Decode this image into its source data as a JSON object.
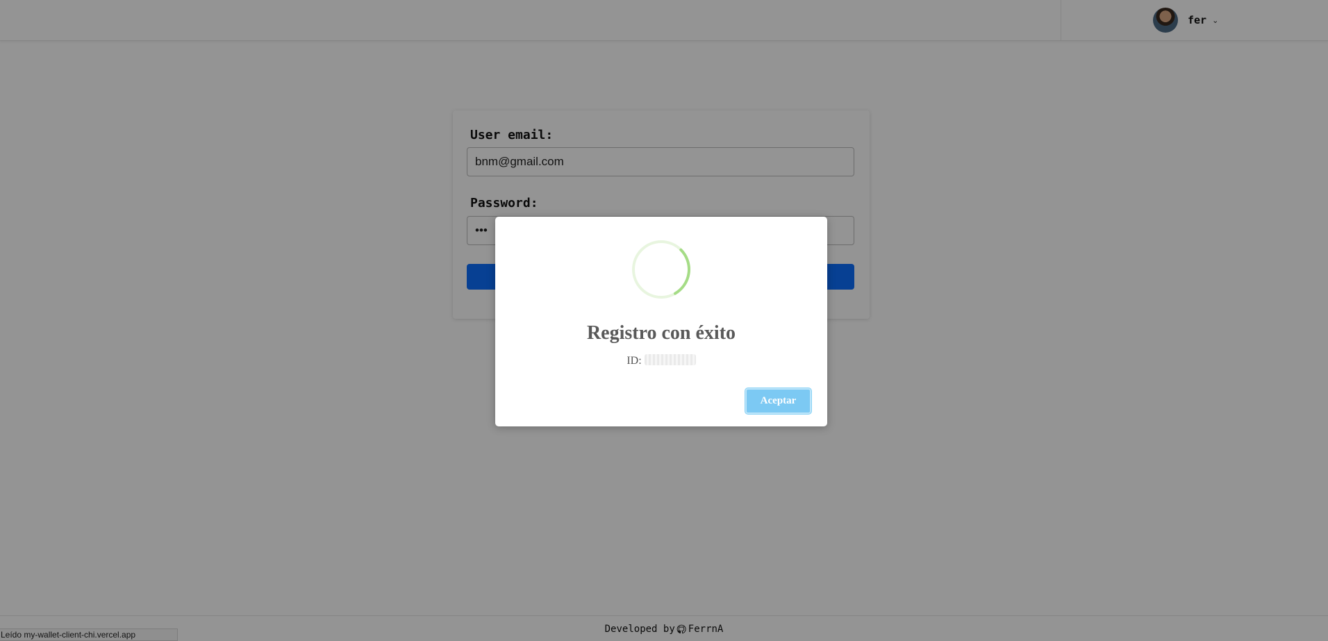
{
  "header": {
    "user_name": "fer",
    "avatar_icon": "user-avatar",
    "chevron_icon": "chevron-down-icon"
  },
  "form": {
    "email_label": "User email:",
    "email_value": "bnm@gmail.com",
    "password_label": "Password:",
    "password_value": "•••",
    "submit_label": ""
  },
  "modal": {
    "title": "Registro con éxito",
    "id_label": "ID:",
    "id_value": "",
    "accept_label": "Aceptar",
    "spinner_color": "#a5dc86"
  },
  "footer": {
    "text": "Developed by",
    "author": "FerrnA",
    "icon": "github-icon"
  },
  "statusbar": {
    "text": "Leído my-wallet-client-chi.vercel.app"
  }
}
